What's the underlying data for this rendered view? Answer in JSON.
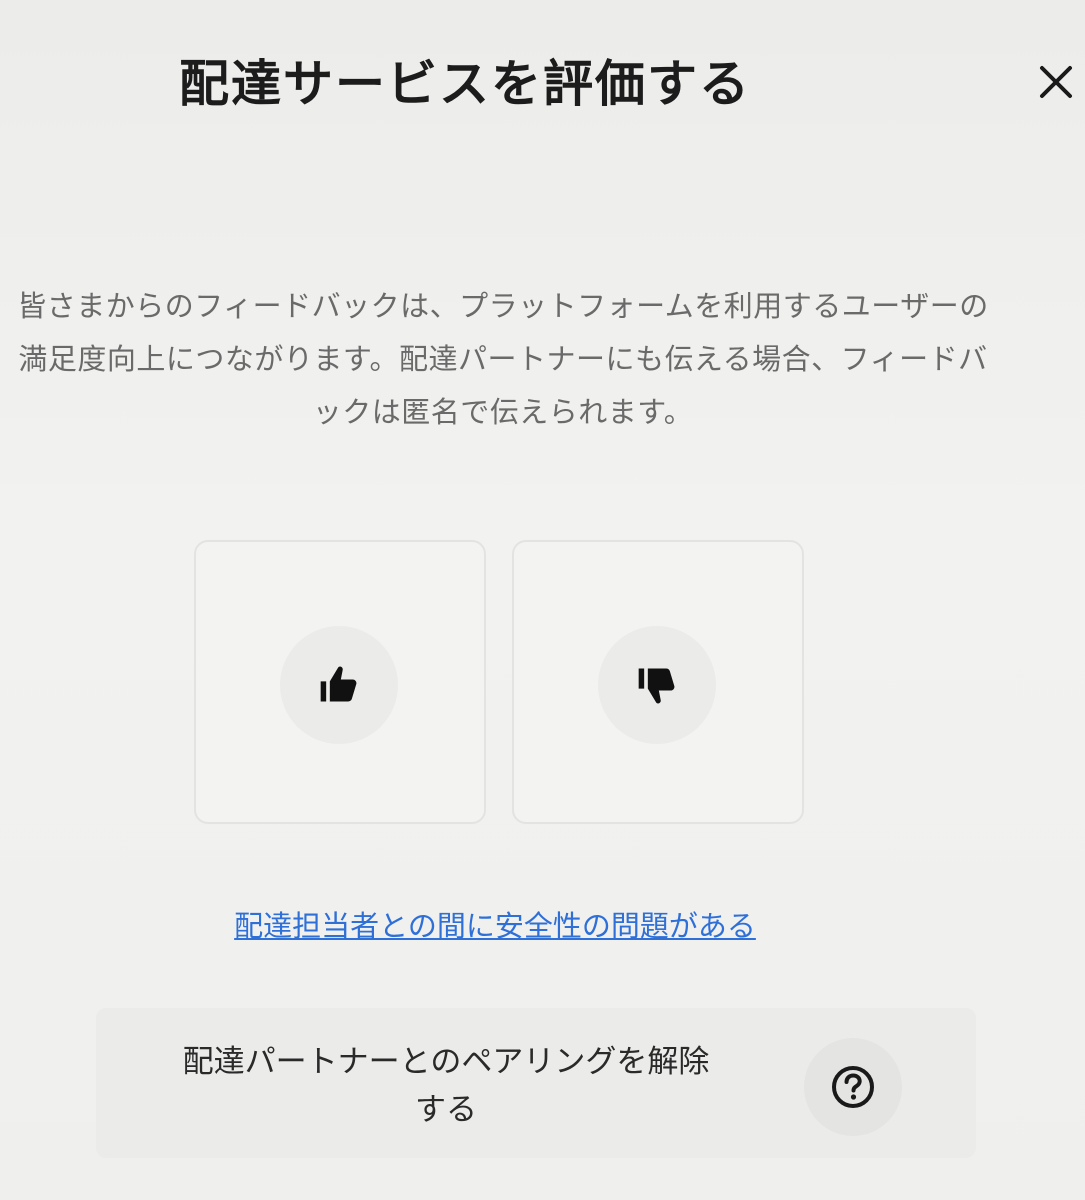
{
  "modal": {
    "title": "配達サービスを評価する",
    "close_icon": "close-icon",
    "description": "皆さまからのフィードバックは、プラットフォームを利用するユーザーの満足度向上につながります。配達パートナーにも伝える場合、フィードバックは匿名で伝えられます。",
    "rating": {
      "thumbs_up_icon": "thumbs-up-icon",
      "thumbs_down_icon": "thumbs-down-icon"
    },
    "safety_link": "配達担当者との間に安全性の問題がある",
    "unpair": {
      "label": "配達パートナーとのペアリングを解除する",
      "help_icon": "help-icon"
    }
  }
}
